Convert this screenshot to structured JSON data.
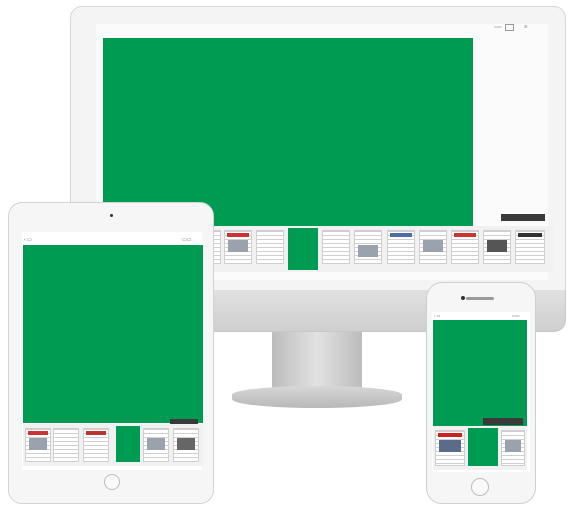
{
  "colors": {
    "accent": "#009b53",
    "tooltip": "#3a3a3a",
    "frame": "#f4f4f4"
  },
  "desktop": {
    "toolbar_icons": [
      "view-icon",
      "pages-icon",
      "menu-icon"
    ],
    "thumbnail_count": 11,
    "selected_thumbnail": 3
  },
  "tablet": {
    "back_icon": "back-icon",
    "menu_icon": "menu-icon",
    "thumbnail_count": 6,
    "selected_thumbnail": 3
  },
  "phone": {
    "back_icon": "back-icon",
    "menu_icon": "menu-icon",
    "thumbnail_count": 3,
    "selected_thumbnail": 1
  }
}
